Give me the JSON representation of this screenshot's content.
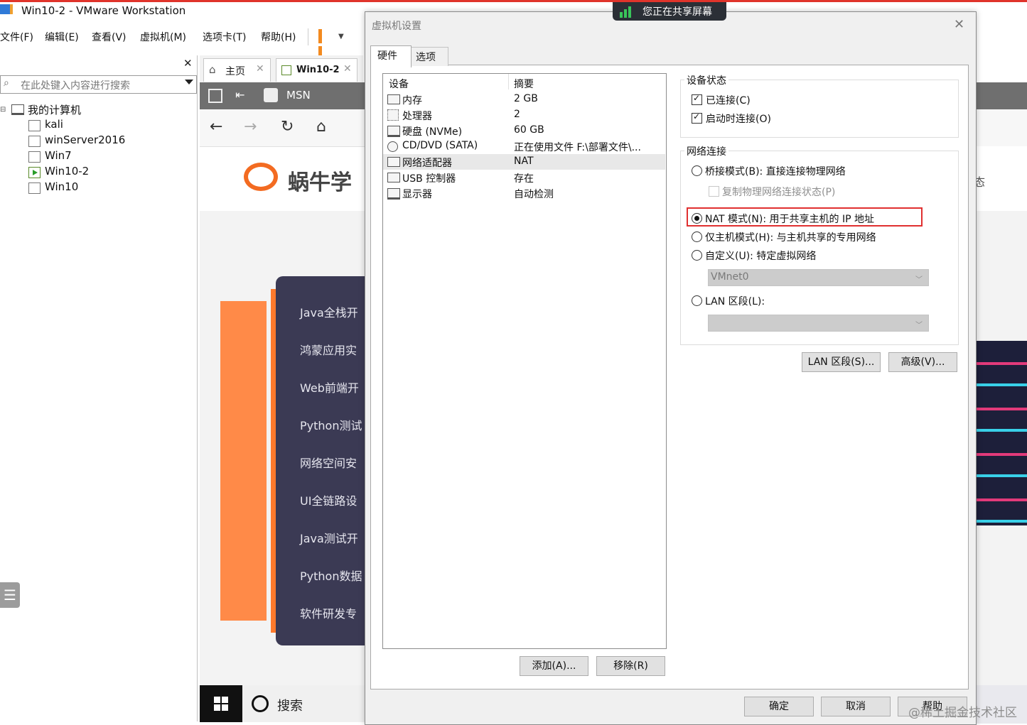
{
  "window": {
    "title": "Win10-2 - VMware Workstation"
  },
  "menu": [
    "文件(F)",
    "编辑(E)",
    "查看(V)",
    "虚拟机(M)",
    "选项卡(T)",
    "帮助(H)"
  ],
  "library": {
    "search_placeholder": "在此处键入内容进行搜索",
    "root": "我的计算机",
    "vms": [
      "kali",
      "winServer2016",
      "Win7",
      "Win10-2",
      "Win10"
    ]
  },
  "tabs": {
    "home": "主页",
    "vm": "Win10-2"
  },
  "guest": {
    "toolbar_label": "MSN",
    "logo_text": "蜗牛学",
    "courses": [
      "Java全栈开",
      "鸿蒙应用实",
      "Web前端开",
      "Python测试",
      "网络空间安",
      "UI全链路设",
      "Java测试开",
      "Python数据",
      "软件研发专"
    ],
    "taskbar_search": "搜索",
    "right_fragment": "态"
  },
  "share_banner": "您正在共享屏幕",
  "dialog": {
    "title": "虚拟机设置",
    "tabs": [
      "硬件",
      "选项"
    ],
    "device_header": "设备",
    "summary_header": "摘要",
    "devices": [
      {
        "name": "内存",
        "summary": "2 GB",
        "icon": "memory-icon"
      },
      {
        "name": "处理器",
        "summary": "2",
        "icon": "processor-icon"
      },
      {
        "name": "硬盘 (NVMe)",
        "summary": "60 GB",
        "icon": "harddisk-icon"
      },
      {
        "name": "CD/DVD (SATA)",
        "summary": "正在使用文件 F:\\部署文件\\...",
        "icon": "cdrom-icon"
      },
      {
        "name": "网络适配器",
        "summary": "NAT",
        "icon": "network-icon"
      },
      {
        "name": "USB 控制器",
        "summary": "存在",
        "icon": "usb-icon"
      },
      {
        "name": "显示器",
        "summary": "自动检测",
        "icon": "display-icon"
      }
    ],
    "add_button": "添加(A)...",
    "remove_button": "移除(R)",
    "device_status": {
      "title": "设备状态",
      "connected": "已连接(C)",
      "connect_at_power_on": "启动时连接(O)"
    },
    "network": {
      "title": "网络连接",
      "bridged": "桥接模式(B): 直接连接物理网络",
      "replicate": "复制物理网络连接状态(P)",
      "nat": "NAT 模式(N): 用于共享主机的 IP 地址",
      "host_only": "仅主机模式(H): 与主机共享的专用网络",
      "custom": "自定义(U): 特定虚拟网络",
      "custom_value": "VMnet0",
      "lan": "LAN 区段(L):",
      "lan_value": ""
    },
    "lan_segments_button": "LAN 区段(S)...",
    "advanced_button": "高级(V)...",
    "ok_button": "确定",
    "cancel_button": "取消",
    "help_button": "帮助"
  },
  "watermark": "@稀土掘金技术社区"
}
